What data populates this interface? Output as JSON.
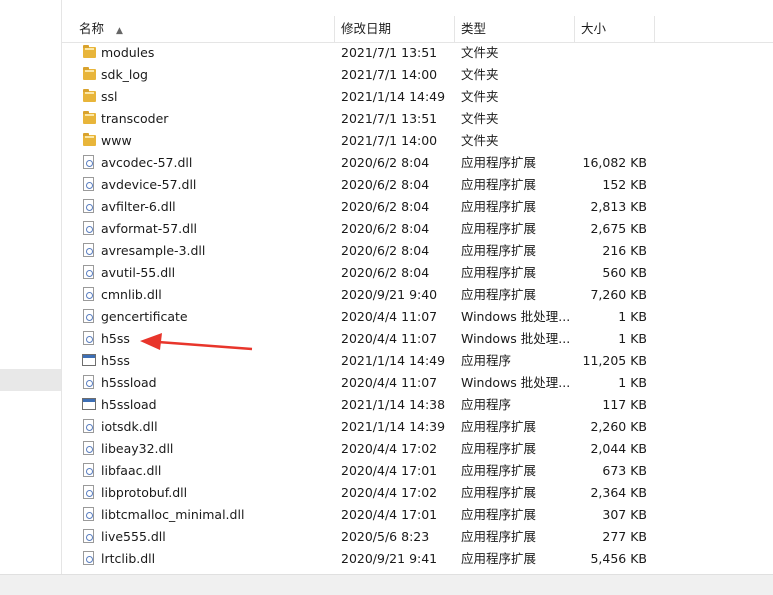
{
  "columns": {
    "name": "名称",
    "date": "修改日期",
    "type": "类型",
    "size": "大小"
  },
  "sort_indicator": "▲",
  "files": [
    {
      "name": "modules",
      "date": "2021/7/1 13:51",
      "type": "文件夹",
      "size": "",
      "icon": "folder-icon"
    },
    {
      "name": "sdk_log",
      "date": "2021/7/1 14:00",
      "type": "文件夹",
      "size": "",
      "icon": "folder-icon"
    },
    {
      "name": "ssl",
      "date": "2021/1/14 14:49",
      "type": "文件夹",
      "size": "",
      "icon": "folder-icon"
    },
    {
      "name": "transcoder",
      "date": "2021/7/1 13:51",
      "type": "文件夹",
      "size": "",
      "icon": "folder-icon"
    },
    {
      "name": "www",
      "date": "2021/7/1 14:00",
      "type": "文件夹",
      "size": "",
      "icon": "folder-icon"
    },
    {
      "name": "avcodec-57.dll",
      "date": "2020/6/2 8:04",
      "type": "应用程序扩展",
      "size": "16,082 KB",
      "icon": "dll-file-icon"
    },
    {
      "name": "avdevice-57.dll",
      "date": "2020/6/2 8:04",
      "type": "应用程序扩展",
      "size": "152 KB",
      "icon": "dll-file-icon"
    },
    {
      "name": "avfilter-6.dll",
      "date": "2020/6/2 8:04",
      "type": "应用程序扩展",
      "size": "2,813 KB",
      "icon": "dll-file-icon"
    },
    {
      "name": "avformat-57.dll",
      "date": "2020/6/2 8:04",
      "type": "应用程序扩展",
      "size": "2,675 KB",
      "icon": "dll-file-icon"
    },
    {
      "name": "avresample-3.dll",
      "date": "2020/6/2 8:04",
      "type": "应用程序扩展",
      "size": "216 KB",
      "icon": "dll-file-icon"
    },
    {
      "name": "avutil-55.dll",
      "date": "2020/6/2 8:04",
      "type": "应用程序扩展",
      "size": "560 KB",
      "icon": "dll-file-icon"
    },
    {
      "name": "cmnlib.dll",
      "date": "2020/9/21 9:40",
      "type": "应用程序扩展",
      "size": "7,260 KB",
      "icon": "dll-file-icon"
    },
    {
      "name": "gencertificate",
      "date": "2020/4/4 11:07",
      "type": "Windows 批处理...",
      "size": "1 KB",
      "icon": "batch-file-icon"
    },
    {
      "name": "h5ss",
      "date": "2020/4/4 11:07",
      "type": "Windows 批处理...",
      "size": "1 KB",
      "icon": "batch-file-icon"
    },
    {
      "name": "h5ss",
      "date": "2021/1/14 14:49",
      "type": "应用程序",
      "size": "11,205 KB",
      "icon": "exe-file-icon"
    },
    {
      "name": "h5ssload",
      "date": "2020/4/4 11:07",
      "type": "Windows 批处理...",
      "size": "1 KB",
      "icon": "batch-file-icon"
    },
    {
      "name": "h5ssload",
      "date": "2021/1/14 14:38",
      "type": "应用程序",
      "size": "117 KB",
      "icon": "exe-file-icon"
    },
    {
      "name": "iotsdk.dll",
      "date": "2021/1/14 14:39",
      "type": "应用程序扩展",
      "size": "2,260 KB",
      "icon": "dll-file-icon"
    },
    {
      "name": "libeay32.dll",
      "date": "2020/4/4 17:02",
      "type": "应用程序扩展",
      "size": "2,044 KB",
      "icon": "dll-file-icon"
    },
    {
      "name": "libfaac.dll",
      "date": "2020/4/4 17:01",
      "type": "应用程序扩展",
      "size": "673 KB",
      "icon": "dll-file-icon"
    },
    {
      "name": "libprotobuf.dll",
      "date": "2020/4/4 17:02",
      "type": "应用程序扩展",
      "size": "2,364 KB",
      "icon": "dll-file-icon"
    },
    {
      "name": "libtcmalloc_minimal.dll",
      "date": "2020/4/4 17:01",
      "type": "应用程序扩展",
      "size": "307 KB",
      "icon": "dll-file-icon"
    },
    {
      "name": "live555.dll",
      "date": "2020/5/6 8:23",
      "type": "应用程序扩展",
      "size": "277 KB",
      "icon": "dll-file-icon"
    },
    {
      "name": "lrtclib.dll",
      "date": "2020/9/21 9:41",
      "type": "应用程序扩展",
      "size": "5,456 KB",
      "icon": "dll-file-icon"
    }
  ],
  "annotation_arrow_color": "#e8352b",
  "folder_color": "#e8b53a"
}
